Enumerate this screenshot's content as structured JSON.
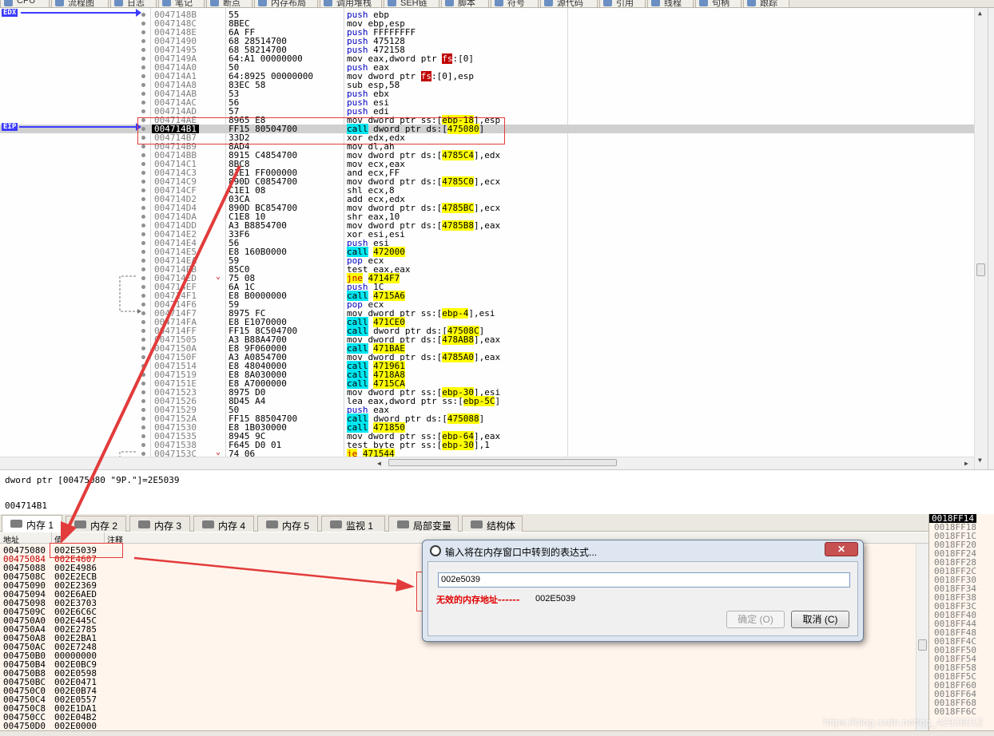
{
  "top_tabs": [
    {
      "label": "CPU"
    },
    {
      "label": "流程图"
    },
    {
      "label": "日志"
    },
    {
      "label": "笔记"
    },
    {
      "label": "断点"
    },
    {
      "label": "内存布局"
    },
    {
      "label": "调用堆栈"
    },
    {
      "label": "SEH链"
    },
    {
      "label": "脚本"
    },
    {
      "label": "符号"
    },
    {
      "label": "源代码"
    },
    {
      "label": "引用"
    },
    {
      "label": "线程"
    },
    {
      "label": "句柄"
    },
    {
      "label": "跟踪"
    }
  ],
  "markers": {
    "edx": "EDX",
    "eip": "EIP"
  },
  "disasm": [
    {
      "addr": "0047148B",
      "bytes": "55",
      "asm": "push ebp",
      "kind": "push"
    },
    {
      "addr": "0047148C",
      "bytes": "8BEC",
      "asm": "mov ebp,esp",
      "kind": "mov"
    },
    {
      "addr": "0047148E",
      "bytes": "6A FF",
      "asm": "push FFFFFFFF",
      "kind": "push"
    },
    {
      "addr": "00471490",
      "bytes": "68 28514700",
      "asm": "push 475128",
      "kind": "push"
    },
    {
      "addr": "00471495",
      "bytes": "68 58214700",
      "asm": "push 472158",
      "kind": "push"
    },
    {
      "addr": "0047149A",
      "bytes": "64:A1 00000000",
      "asm": "mov eax,dword ptr fs:[0]",
      "kind": "mov"
    },
    {
      "addr": "004714A0",
      "bytes": "50",
      "asm": "push eax",
      "kind": "push"
    },
    {
      "addr": "004714A1",
      "bytes": "64:8925 00000000",
      "asm": "mov dword ptr fs:[0],esp",
      "kind": "mov"
    },
    {
      "addr": "004714A8",
      "bytes": "83EC 58",
      "asm": "sub esp,58",
      "kind": "other"
    },
    {
      "addr": "004714AB",
      "bytes": "53",
      "asm": "push ebx",
      "kind": "push"
    },
    {
      "addr": "004714AC",
      "bytes": "56",
      "asm": "push esi",
      "kind": "push"
    },
    {
      "addr": "004714AD",
      "bytes": "57",
      "asm": "push edi",
      "kind": "push"
    },
    {
      "addr": "004714AE",
      "bytes": "8965 E8",
      "asm": "mov dword ptr ss:[ebp-18],esp",
      "kind": "mov"
    },
    {
      "addr": "004714B1",
      "bytes": "FF15 80504700",
      "asm": "call dword ptr ds:[475080]",
      "kind": "call",
      "eip": true
    },
    {
      "addr": "004714B7",
      "bytes": "33D2",
      "asm": "xor edx,edx",
      "kind": "other"
    },
    {
      "addr": "004714B9",
      "bytes": "8AD4",
      "asm": "mov dl,ah",
      "kind": "mov"
    },
    {
      "addr": "004714BB",
      "bytes": "8915 C4854700",
      "asm": "mov dword ptr ds:[4785C4],edx",
      "kind": "mov"
    },
    {
      "addr": "004714C1",
      "bytes": "8BC8",
      "asm": "mov ecx,eax",
      "kind": "mov"
    },
    {
      "addr": "004714C3",
      "bytes": "81E1 FF000000",
      "asm": "and ecx,FF",
      "kind": "other"
    },
    {
      "addr": "004714C9",
      "bytes": "890D C0854700",
      "asm": "mov dword ptr ds:[4785C0],ecx",
      "kind": "mov"
    },
    {
      "addr": "004714CF",
      "bytes": "C1E1 08",
      "asm": "shl ecx,8",
      "kind": "other"
    },
    {
      "addr": "004714D2",
      "bytes": "03CA",
      "asm": "add ecx,edx",
      "kind": "other"
    },
    {
      "addr": "004714D4",
      "bytes": "890D BC854700",
      "asm": "mov dword ptr ds:[4785BC],ecx",
      "kind": "mov"
    },
    {
      "addr": "004714DA",
      "bytes": "C1E8 10",
      "asm": "shr eax,10",
      "kind": "other"
    },
    {
      "addr": "004714DD",
      "bytes": "A3 B8854700",
      "asm": "mov dword ptr ds:[4785B8],eax",
      "kind": "mov"
    },
    {
      "addr": "004714E2",
      "bytes": "33F6",
      "asm": "xor esi,esi",
      "kind": "other"
    },
    {
      "addr": "004714E4",
      "bytes": "56",
      "asm": "push esi",
      "kind": "push"
    },
    {
      "addr": "004714E5",
      "bytes": "E8 160B0000",
      "asm": "call 472000",
      "kind": "call"
    },
    {
      "addr": "004714EA",
      "bytes": "59",
      "asm": "pop ecx",
      "kind": "push"
    },
    {
      "addr": "004714EB",
      "bytes": "85C0",
      "asm": "test eax,eax",
      "kind": "other"
    },
    {
      "addr": "004714ED",
      "bytes": "75 08",
      "asm": "jne 4714F7",
      "kind": "jmp"
    },
    {
      "addr": "004714EF",
      "bytes": "6A 1C",
      "asm": "push 1C",
      "kind": "push"
    },
    {
      "addr": "004714F1",
      "bytes": "E8 B0000000",
      "asm": "call 4715A6",
      "kind": "call"
    },
    {
      "addr": "004714F6",
      "bytes": "59",
      "asm": "pop ecx",
      "kind": "push"
    },
    {
      "addr": "004714F7",
      "bytes": "8975 FC",
      "asm": "mov dword ptr ss:[ebp-4],esi",
      "kind": "mov"
    },
    {
      "addr": "004714FA",
      "bytes": "E8 E1070000",
      "asm": "call 471CE0",
      "kind": "call"
    },
    {
      "addr": "004714FF",
      "bytes": "FF15 8C504700",
      "asm": "call dword ptr ds:[47508C]",
      "kind": "call"
    },
    {
      "addr": "00471505",
      "bytes": "A3 B88A4700",
      "asm": "mov dword ptr ds:[478AB8],eax",
      "kind": "mov"
    },
    {
      "addr": "0047150A",
      "bytes": "E8 9F060000",
      "asm": "call 471BAE",
      "kind": "call"
    },
    {
      "addr": "0047150F",
      "bytes": "A3 A0854700",
      "asm": "mov dword ptr ds:[4785A0],eax",
      "kind": "mov"
    },
    {
      "addr": "00471514",
      "bytes": "E8 48040000",
      "asm": "call 471961",
      "kind": "call"
    },
    {
      "addr": "00471519",
      "bytes": "E8 8A030000",
      "asm": "call 4718A8",
      "kind": "call"
    },
    {
      "addr": "0047151E",
      "bytes": "E8 A7000000",
      "asm": "call 4715CA",
      "kind": "call"
    },
    {
      "addr": "00471523",
      "bytes": "8975 D0",
      "asm": "mov dword ptr ss:[ebp-30],esi",
      "kind": "mov"
    },
    {
      "addr": "00471526",
      "bytes": "8D45 A4",
      "asm": "lea eax,dword ptr ss:[ebp-5C]",
      "kind": "other"
    },
    {
      "addr": "00471529",
      "bytes": "50",
      "asm": "push eax",
      "kind": "push"
    },
    {
      "addr": "0047152A",
      "bytes": "FF15 88504700",
      "asm": "call dword ptr ds:[475088]",
      "kind": "call"
    },
    {
      "addr": "00471530",
      "bytes": "E8 1B030000",
      "asm": "call 471850",
      "kind": "call"
    },
    {
      "addr": "00471535",
      "bytes": "8945 9C",
      "asm": "mov dword ptr ss:[ebp-64],eax",
      "kind": "mov"
    },
    {
      "addr": "00471538",
      "bytes": "F645 D0 01",
      "asm": "test byte ptr ss:[ebp-30],1",
      "kind": "other"
    },
    {
      "addr": "0047153C",
      "bytes": "74 06",
      "asm": "je 471544",
      "kind": "jmp"
    }
  ],
  "info": {
    "line1": "dword ptr [00475080 \"9P.\"]=2E5039",
    "line2": "004714B1"
  },
  "mem_tabs": [
    {
      "label": "内存 1"
    },
    {
      "label": "内存 2"
    },
    {
      "label": "内存 3"
    },
    {
      "label": "内存 4"
    },
    {
      "label": "内存 5"
    },
    {
      "label": "监视 1"
    },
    {
      "label": "局部变量"
    },
    {
      "label": "结构体"
    }
  ],
  "mem_header": {
    "addr": "地址",
    "value": "值",
    "comment": "注释"
  },
  "memory": [
    {
      "addr": "00475080",
      "value": "002E5039"
    },
    {
      "addr": "00475084",
      "value": "002E4607"
    },
    {
      "addr": "00475088",
      "value": "002E4986"
    },
    {
      "addr": "0047508C",
      "value": "002E2ECB"
    },
    {
      "addr": "00475090",
      "value": "002E2369"
    },
    {
      "addr": "00475094",
      "value": "002E6AED"
    },
    {
      "addr": "00475098",
      "value": "002E3703"
    },
    {
      "addr": "0047509C",
      "value": "002E6C6C"
    },
    {
      "addr": "004750A0",
      "value": "002E445C"
    },
    {
      "addr": "004750A4",
      "value": "002E2785"
    },
    {
      "addr": "004750A8",
      "value": "002E2BA1"
    },
    {
      "addr": "004750AC",
      "value": "002E7248"
    },
    {
      "addr": "004750B0",
      "value": "00000000"
    },
    {
      "addr": "004750B4",
      "value": "002E0BC9"
    },
    {
      "addr": "004750B8",
      "value": "002E0598"
    },
    {
      "addr": "004750BC",
      "value": "002E0471"
    },
    {
      "addr": "004750C0",
      "value": "002E0B74"
    },
    {
      "addr": "004750C4",
      "value": "002E0557"
    },
    {
      "addr": "004750C8",
      "value": "002E1DA1"
    },
    {
      "addr": "004750CC",
      "value": "002E04B2"
    },
    {
      "addr": "004750D0",
      "value": "002E0000"
    }
  ],
  "stack": [
    "0018FF14",
    "0018FF18",
    "0018FF1C",
    "0018FF20",
    "0018FF24",
    "0018FF28",
    "0018FF2C",
    "0018FF30",
    "0018FF34",
    "0018FF38",
    "0018FF3C",
    "0018FF40",
    "0018FF44",
    "0018FF48",
    "0018FF4C",
    "0018FF50",
    "0018FF54",
    "0018FF58",
    "0018FF5C",
    "0018FF60",
    "0018FF64",
    "0018FF68",
    "0018FF6C"
  ],
  "dialog": {
    "title": "输入将在内存窗口中转到的表达式...",
    "input_value": "002e5039",
    "error_text": "无效的内存地址------",
    "error_value": "002E5039",
    "ok_label": "确定 (O)",
    "cancel_label": "取消 (C)",
    "close_glyph": "✕"
  },
  "watermark": "https://blog.csdn.net/qq_42926012",
  "colors": {
    "annotation_red": "#e23b3b",
    "marker_blue": "#3c3cff",
    "call_cyan": "#00e6f0",
    "jump_yellow": "#ffff00"
  }
}
